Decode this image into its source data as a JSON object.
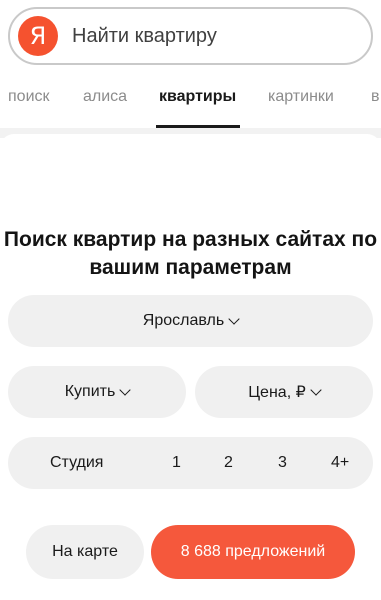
{
  "search": {
    "placeholder": "Найти квартиру",
    "logo_letter": "Я"
  },
  "tabs": [
    {
      "label": "поиск"
    },
    {
      "label": "алиса"
    },
    {
      "label": "квартиры",
      "active": true
    },
    {
      "label": "картинки"
    },
    {
      "label": "в"
    }
  ],
  "heading": "Поиск квартир на разных сайтах по вашим параметрам",
  "filters": {
    "city": "Ярославль",
    "deal": "Купить",
    "price": "Цена, ₽"
  },
  "rooms": [
    "Студия",
    "1",
    "2",
    "3",
    "4+"
  ],
  "actions": {
    "map_label": "На карте",
    "offers_label": "8 688 предложений"
  },
  "colors": {
    "accent": "#f5583c",
    "pill_bg": "#f0f0f0"
  }
}
